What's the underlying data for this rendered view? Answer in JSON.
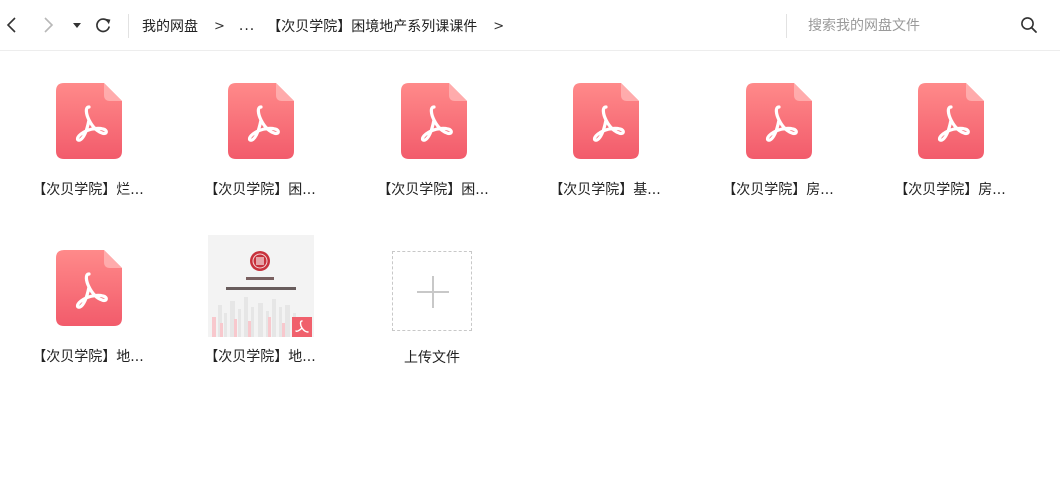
{
  "toolbar": {
    "back_icon": "chevron-left-icon",
    "forward_icon": "chevron-right-icon",
    "history_dropdown_icon": "caret-down-icon",
    "refresh_icon": "refresh-icon",
    "breadcrumb": {
      "root": "我的网盘",
      "separator": ">",
      "ellipsis": "...",
      "current": "【次贝学院】困境地产系列课课件"
    },
    "search": {
      "placeholder": "搜索我的网盘文件",
      "value": "",
      "icon": "search-icon"
    }
  },
  "files": [
    {
      "label": "【次贝学院】烂...",
      "icon": "pdf-file-icon"
    },
    {
      "label": "【次贝学院】困...",
      "icon": "pdf-file-icon"
    },
    {
      "label": "【次贝学院】困...",
      "icon": "pdf-file-icon"
    },
    {
      "label": "【次贝学院】基...",
      "icon": "pdf-file-icon"
    },
    {
      "label": "【次贝学院】房...",
      "icon": "pdf-file-icon"
    },
    {
      "label": "【次贝学院】房...",
      "icon": "pdf-file-icon"
    },
    {
      "label": "【次贝学院】地...",
      "icon": "pdf-file-icon"
    },
    {
      "label": "【次贝学院】地...",
      "icon": "pdf-thumbnail",
      "thumbnail": {
        "title": "次贝学院",
        "slogan": "和百万金融人一起成长"
      }
    }
  ],
  "upload": {
    "label": "上传文件",
    "icon": "plus-icon"
  },
  "colors": {
    "pdf_gradient_top": "#ff8a8a",
    "pdf_gradient_bottom": "#f25b6b",
    "accent_red": "#e8505b"
  }
}
